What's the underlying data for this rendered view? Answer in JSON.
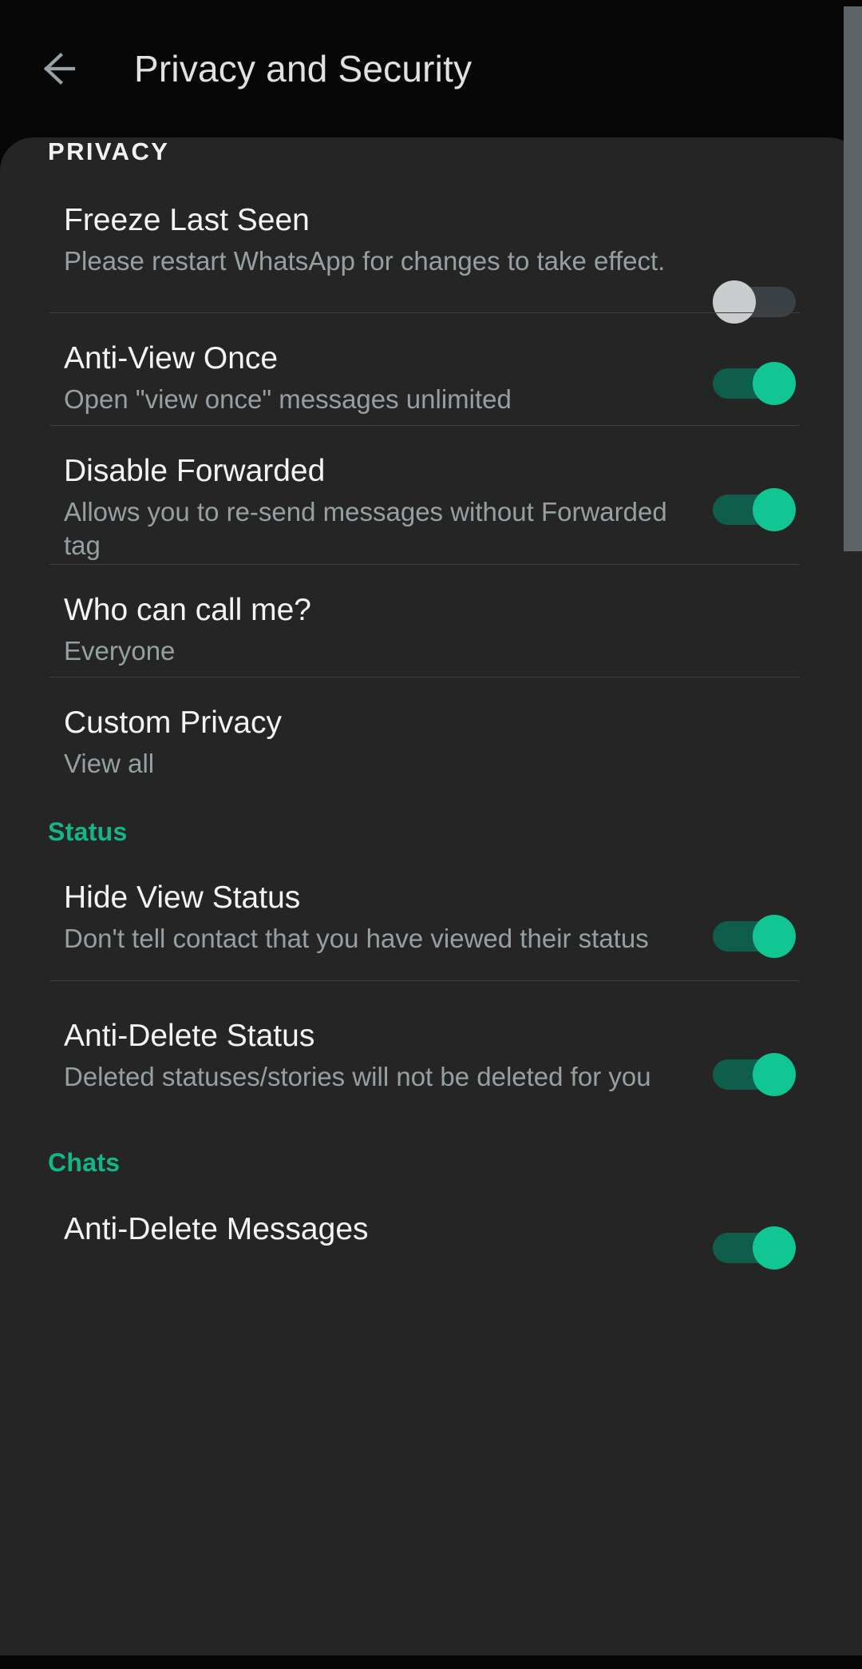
{
  "appbar": {
    "back_icon": "arrow-left-icon",
    "title": "Privacy and Security"
  },
  "colors": {
    "accent_green": "#13b787",
    "toggle_on_thumb": "#12c694",
    "toggle_on_track": "#0f5e4b",
    "toggle_off_thumb": "#c9cdcd",
    "toggle_off_track": "#3b4144",
    "panel_background": "#252525",
    "screen_background": "#070707",
    "title_text": "#f3f4f4",
    "subtitle_text": "#96a0a3",
    "divider": "#3a3d3e",
    "scrollbar": "#5c6468"
  },
  "sections": {
    "privacy": {
      "header": "PRIVACY",
      "rows": {
        "freeze_last_seen": {
          "title": "Freeze Last Seen",
          "subtitle": "Please restart WhatsApp for changes to take effect.",
          "toggle_state": "off"
        },
        "anti_view_once": {
          "title": "Anti-View Once",
          "subtitle": "Open \"view once\" messages unlimited",
          "toggle_state": "on"
        },
        "disable_forwarded": {
          "title": "Disable Forwarded",
          "subtitle": "Allows you to re-send messages without Forwarded tag",
          "toggle_state": "on"
        },
        "who_can_call_me": {
          "title": "Who can call me?",
          "subtitle": "Everyone"
        },
        "custom_privacy": {
          "title": "Custom Privacy",
          "subtitle": "View all"
        }
      }
    },
    "status": {
      "header": "Status",
      "rows": {
        "hide_view_status": {
          "title": "Hide View Status",
          "subtitle": "Don't tell contact that you have viewed their status",
          "toggle_state": "on"
        },
        "anti_delete_status": {
          "title": "Anti-Delete Status",
          "subtitle": "Deleted statuses/stories will not be deleted for you",
          "toggle_state": "on"
        }
      }
    },
    "chats": {
      "header": "Chats",
      "rows": {
        "anti_delete_messages": {
          "title": "Anti-Delete Messages",
          "toggle_state": "on"
        }
      }
    }
  }
}
